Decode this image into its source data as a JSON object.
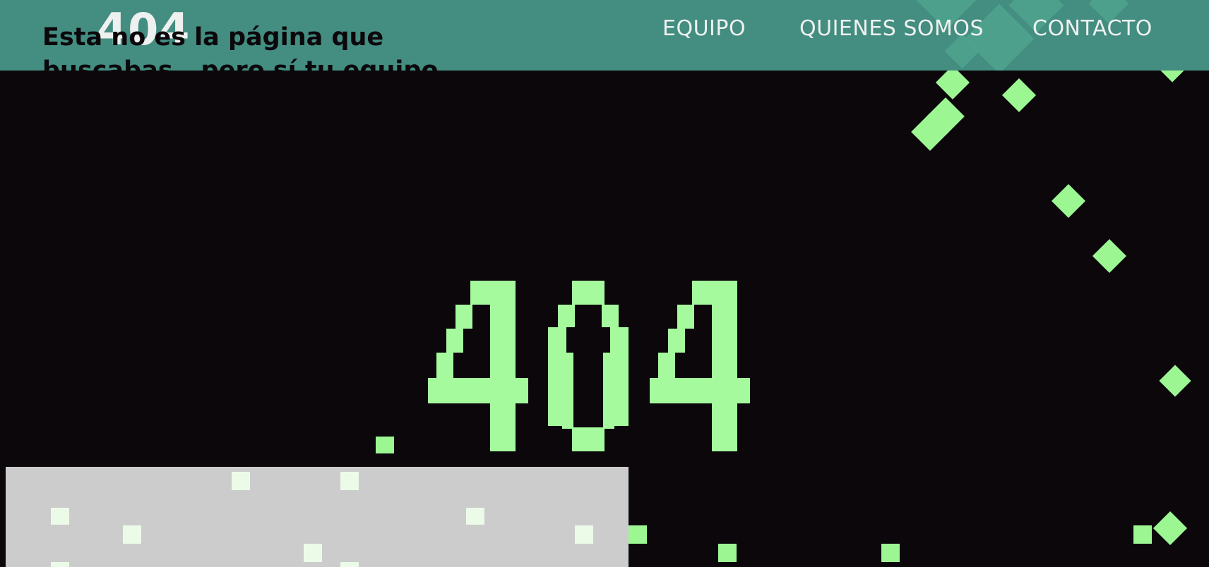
{
  "header": {
    "logo_text": "404",
    "nav": [
      {
        "label": "EQUIPO"
      },
      {
        "label": "QUIENES SOMOS"
      },
      {
        "label": "CONTACTO"
      }
    ]
  },
  "hero": {
    "error_code": "404"
  },
  "message": {
    "text": "Esta no es la página que buscabas...pero sí tu equipo"
  },
  "colors": {
    "navbar": "#438d81",
    "background": "#0b070b",
    "pixel_green": "#a6fa9e",
    "message_box": "#cccccc"
  }
}
